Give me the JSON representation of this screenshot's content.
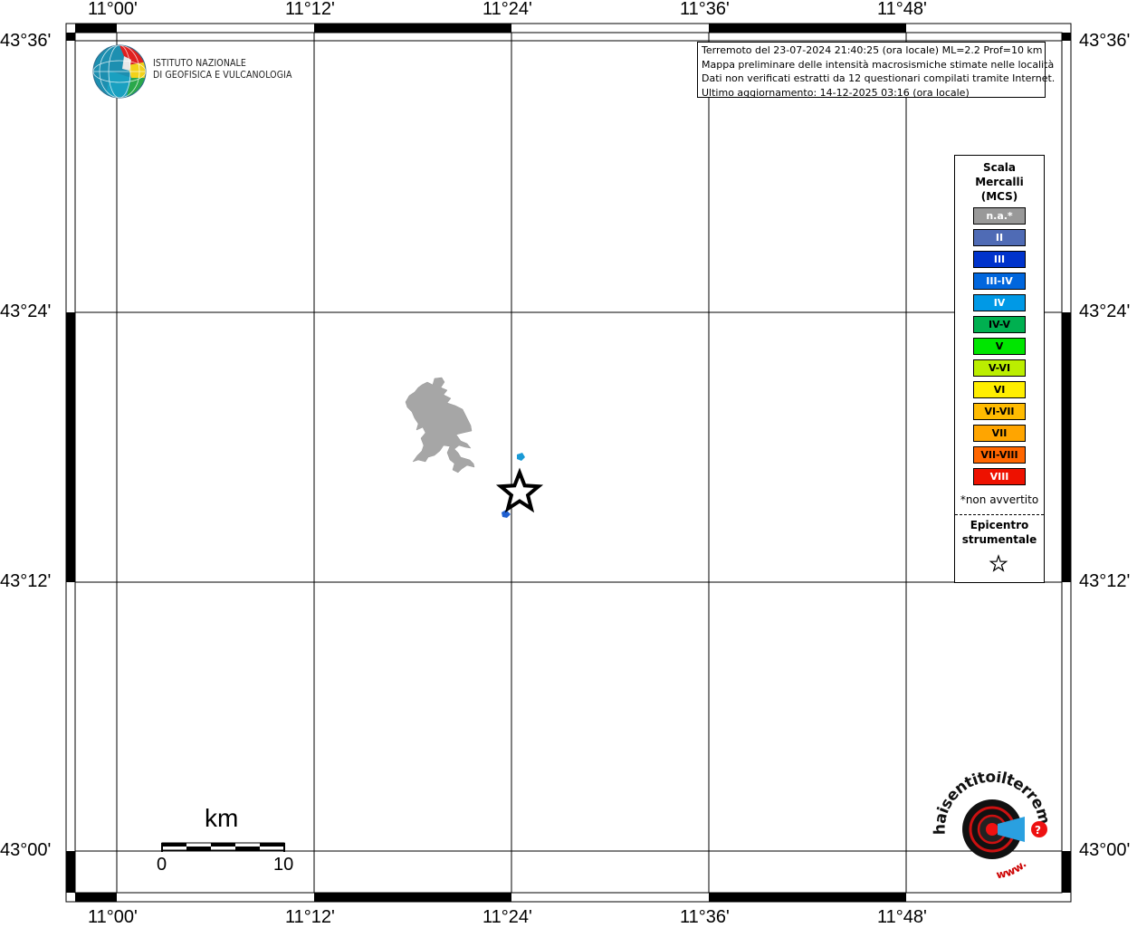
{
  "map": {
    "lon_ticks": [
      "11°00'",
      "11°12'",
      "11°24'",
      "11°36'",
      "11°48'"
    ],
    "lat_ticks": [
      "43°36'",
      "43°24'",
      "43°12'",
      "43°00'"
    ],
    "colors": {
      "frame": "#000000",
      "grid": "#000000",
      "lake": "#a6a6a6",
      "background": "#ffffff"
    }
  },
  "logo": {
    "line1": "ISTITUTO NAZIONALE",
    "line2": "DI GEOFISICA E VULCANOLOGIA"
  },
  "info_box": {
    "line1": "Terremoto del 23-07-2024 21:40:25 (ora locale) ML=2.2 Prof=10 km",
    "line2": "Mappa preliminare delle intensità macrosismiche stimate nelle località",
    "line3": "Dati non verificati estratti da 12 questionari compilati tramite Internet.",
    "line4": "Ultimo aggiornamento: 14-12-2025 03:16 (ora locale)"
  },
  "legend": {
    "title_line1": "Scala",
    "title_line2": "Mercalli",
    "title_line3": "(MCS)",
    "items": [
      {
        "label": "n.a.*",
        "color": "#999999",
        "text_color": "#ffffff"
      },
      {
        "label": "II",
        "color": "#4f6bb5",
        "text_color": "#ffffff"
      },
      {
        "label": "III",
        "color": "#0033cc",
        "text_color": "#ffffff"
      },
      {
        "label": "III-IV",
        "color": "#0066dd",
        "text_color": "#ffffff"
      },
      {
        "label": "IV",
        "color": "#0099e6",
        "text_color": "#ffffff"
      },
      {
        "label": "IV-V",
        "color": "#00b050",
        "text_color": "#000000"
      },
      {
        "label": "V",
        "color": "#00e600",
        "text_color": "#000000"
      },
      {
        "label": "V-VI",
        "color": "#bbee00",
        "text_color": "#000000"
      },
      {
        "label": "VI",
        "color": "#ffee00",
        "text_color": "#000000"
      },
      {
        "label": "VI-VII",
        "color": "#ffbb00",
        "text_color": "#000000"
      },
      {
        "label": "VII",
        "color": "#ffa500",
        "text_color": "#000000"
      },
      {
        "label": "VII-VIII",
        "color": "#ff6600",
        "text_color": "#000000"
      },
      {
        "label": "VIII",
        "color": "#ee1100",
        "text_color": "#ffffff"
      }
    ],
    "not_felt_note": "*non avvertito",
    "epicenter_line1": "Epicentro",
    "epicenter_line2": "strumentale"
  },
  "scale_bar": {
    "unit": "km",
    "label_start": "0",
    "label_end": "10"
  },
  "observations": [
    {
      "intensity": "IV",
      "color": "#1a9ad6"
    },
    {
      "intensity": "III-IV",
      "color": "#1f5fd0"
    }
  ],
  "brand": {
    "text": "haisentitoilterremoto.it",
    "prefix": "www."
  }
}
